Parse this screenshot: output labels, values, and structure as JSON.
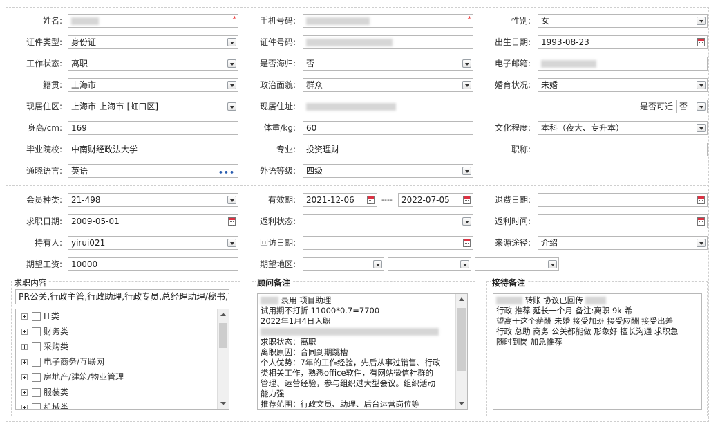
{
  "profile": {
    "name": {
      "label": "姓名:",
      "required": "*"
    },
    "phone": {
      "label": "手机号码:",
      "required": "*"
    },
    "gender": {
      "label": "性别:",
      "value": "女"
    },
    "id_type": {
      "label": "证件类型:",
      "value": "身份证"
    },
    "id_number": {
      "label": "证件号码:"
    },
    "birth_date": {
      "label": "出生日期:",
      "value": "1993-08-23"
    },
    "work_status": {
      "label": "工作状态:",
      "value": "离职"
    },
    "returnee": {
      "label": "是否海归:",
      "value": "否"
    },
    "email": {
      "label": "电子邮箱:"
    },
    "native_place": {
      "label": "籍贯:",
      "value": "上海市"
    },
    "political": {
      "label": "政治面貌:",
      "value": "群众"
    },
    "marital": {
      "label": "婚育状况:",
      "value": "未婚"
    },
    "residence_area": {
      "label": "现居住区:",
      "value": "上海市-上海市-[虹口区]"
    },
    "residence_address": {
      "label": "现居住址:"
    },
    "relocatable": {
      "label": "是否可迁",
      "value": "否"
    },
    "height": {
      "label": "身高/cm:",
      "value": "169"
    },
    "weight": {
      "label": "体重/kg:",
      "value": "60"
    },
    "education": {
      "label": "文化程度:",
      "value": "本科（夜大、专升本）"
    },
    "school": {
      "label": "毕业院校:",
      "value": "中南财经政法大学"
    },
    "major": {
      "label": "专业:",
      "value": "投资理财"
    },
    "title": {
      "label": "职称:",
      "value": ""
    },
    "language": {
      "label": "通晓语言:",
      "value": "英语",
      "more": "•••"
    },
    "language_level": {
      "label": "外语等级:",
      "value": "四级"
    }
  },
  "membership": {
    "member_type": {
      "label": "会员种类:",
      "value": "21-498"
    },
    "validity": {
      "label": "有效期:",
      "from": "2021-12-06",
      "sep": "----",
      "to": "2022-07-05"
    },
    "refund_date": {
      "label": "退费日期:",
      "value": ""
    },
    "job_date": {
      "label": "求职日期:",
      "value": "2009-05-01"
    },
    "rebate_status": {
      "label": "返利状态:",
      "value": ""
    },
    "rebate_time": {
      "label": "返利时间:",
      "value": ""
    },
    "holder": {
      "label": "持有人:",
      "value": "yirui021"
    },
    "revisit_date": {
      "label": "回访日期:",
      "value": ""
    },
    "source": {
      "label": "来源途径:",
      "value": "介绍"
    },
    "expected_salary": {
      "label": "期望工资:",
      "value": "10000"
    },
    "expected_area": {
      "label": "期望地区:"
    }
  },
  "job_content": {
    "header": "求职内容",
    "summary": "PR公关,行政主管,行政助理,行政专员,总经理助理/秘书,商务",
    "categories": [
      "IT类",
      "财务类",
      "采购类",
      "电子商务/互联网",
      "房地产/建筑/物业管理",
      "服装类",
      "机械类"
    ]
  },
  "advisor_notes": {
    "header": "顾问备注",
    "lines": [
      "录用 项目助理",
      "试用期不打折 11000*0.7=7700",
      "2022年1月4日入职",
      "",
      "求职状态：离职",
      "离职原因：合同到期跳槽",
      "个人优势：7年的工作经验，先后从事过销售、行政",
      "类相关工作，熟悉office软件，有网站微信社群的",
      "管理、运营经验，参与组织过大型会议。组织活动",
      "能力强",
      "推荐范围：行政文员、助理、后台运营岗位等"
    ]
  },
  "reception_notes": {
    "header": "接待备注",
    "lines": [
      "转账 协议已回传",
      "行政 推荐 延长一个月 备注:离职 9k 希",
      "望高于这个薪酬 未婚 接受加班 接受应酬 接受出差",
      "行政 总助 商务 公关都能做 形象好 擅长沟通 求职急",
      "随时到岗 加急推荐"
    ]
  },
  "colors": {
    "border": "#b8b8b8",
    "required": "#ee3333",
    "link": "#2a5db0"
  }
}
